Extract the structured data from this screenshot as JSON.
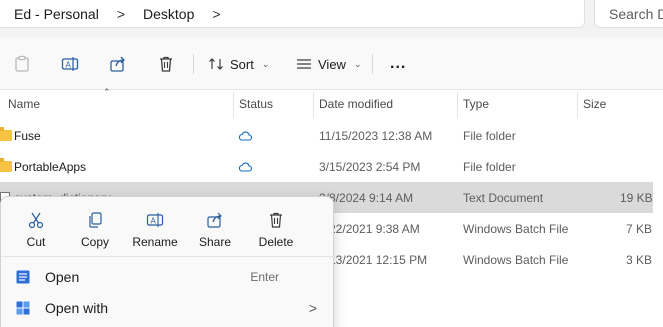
{
  "address": {
    "crumbs": [
      "Ed - Personal",
      "Desktop"
    ],
    "separator": ">",
    "search_placeholder": "Search D"
  },
  "toolbar": {
    "sort_label": "Sort",
    "view_label": "View",
    "more_label": "..."
  },
  "columns": {
    "name": "Name",
    "status": "Status",
    "date_modified": "Date modified",
    "type": "Type",
    "size": "Size"
  },
  "files": [
    {
      "name": "Fuse",
      "date": "11/15/2023 12:38 AM",
      "type": "File folder",
      "size": ""
    },
    {
      "name": "PortableApps",
      "date": "3/15/2023 2:54 PM",
      "type": "File folder",
      "size": ""
    },
    {
      "name": "custom_dictionary",
      "date": "3/8/2024 9:14 AM",
      "type": "Text Document",
      "size": "19 KB"
    },
    {
      "name": "",
      "date": "2/22/2021 9:38 AM",
      "type": "Windows Batch File",
      "size": "7 KB"
    },
    {
      "name": "",
      "date": "5/13/2021 12:15 PM",
      "type": "Windows Batch File",
      "size": "3 KB"
    }
  ],
  "context_menu": {
    "quick_actions": [
      "Cut",
      "Copy",
      "Rename",
      "Share",
      "Delete"
    ],
    "items": [
      {
        "label": "Open",
        "accelerator": "Enter"
      },
      {
        "label": "Open with",
        "submenu": ">"
      }
    ]
  },
  "colors": {
    "accent": "#0067c0",
    "folder": "#f6c343",
    "highlight_row": "#dadada"
  }
}
